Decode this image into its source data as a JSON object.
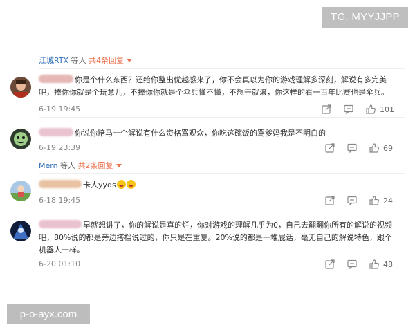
{
  "watermarks": {
    "tg": "TG: MYYJJPP",
    "site": "p-o-ayx.com"
  },
  "reply_summaries": [
    {
      "user": "江城RTX",
      "mid": " 等人 ",
      "count": "共4条回复"
    },
    {
      "user": "Mern",
      "mid": " 等人 ",
      "count": "共2条回复"
    }
  ],
  "comments": [
    {
      "text": "你是个什么东西？还给你整出优越感来了，你不会真以为你的游戏理解多深刻，解说有多完美吧，捧你你就是个玩意儿，不捧你你就是个伞兵懂不懂，不想干就滚，你这样的看一百年比赛也是伞兵。",
      "time": "6-19 19:45",
      "likes": "101",
      "icons": [
        "share-icon",
        "comment-icon",
        "like-icon"
      ]
    },
    {
      "text": "你说你赔马一个解说有什么资格骂观众，你吃这碗饭的骂爹妈我是不明白的",
      "time": "6-19 23:39",
      "likes": "69",
      "icons": [
        "share-icon",
        "comment-icon",
        "like-icon"
      ]
    },
    {
      "text": "卡人yyds",
      "time": "6-18 19:45",
      "likes": "24",
      "icons": [
        "share-icon",
        "comment-icon",
        "like-icon"
      ]
    },
    {
      "text": "早就想讲了，你的解说是真的烂，你对游戏的理解几乎为0，自己去翻翻你所有的解说的视频吧，80%说的都是旁边搭档说过的，你只是在重复。20%说的都是一堆屁话，毫无自己的解说特色，跟个机器人一样。",
      "time": "6-20 01:10",
      "likes": "48",
      "icons": [
        "share-icon",
        "comment-icon",
        "like-icon"
      ]
    }
  ]
}
